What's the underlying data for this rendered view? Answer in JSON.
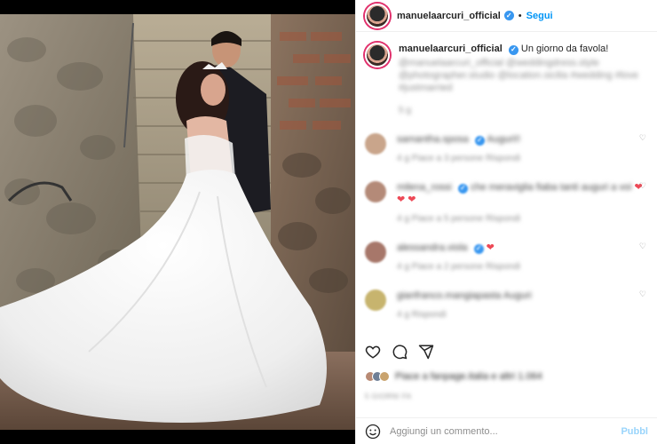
{
  "post": {
    "username": "manuelaarcuri_official",
    "follow_label": "Segui",
    "separator": "•",
    "caption": "Un giorno da favola!",
    "caption_blurred": "@manuelaarcuri_official @weddingdress.style @photographer.studio @location.sicilia #wedding #love #justmarried",
    "caption_time": "5 g"
  },
  "comments": [
    {
      "user": "samantha.sposa",
      "text": "Auguri!!",
      "meta": "4 g   Piace a 3 persone   Rispondi",
      "avatar_color": "#c9a58b",
      "hearts": ""
    },
    {
      "user": "milena_rossi",
      "text": "che meraviglia fiaba tanti auguri a voi",
      "meta": "4 g   Piace a 5 persone   Rispondi",
      "avatar_color": "#b48a78",
      "hearts": "❤ ❤ ❤"
    },
    {
      "user": "alessandra.viola",
      "text": "",
      "meta": "4 g   Piace a 2 persone   Rispondi",
      "avatar_color": "#a7776a",
      "hearts": "❤"
    },
    {
      "user": "gianfranco.mangiapasta",
      "text": "Auguri",
      "meta": "4 g   Rispondi",
      "avatar_color": "#c7b46e",
      "hearts": ""
    }
  ],
  "actions": {
    "like": "heart-icon",
    "comment": "comment-icon",
    "share": "share-icon"
  },
  "likes": {
    "text": "Piace a fanpage.italia e altri 1.064"
  },
  "date": "5 GIORNI FA",
  "add_comment": {
    "placeholder": "Aggiungi un commento...",
    "publish_label": "Pubbl"
  },
  "colors": {
    "accent": "#0095f6",
    "verified": "#3897f0",
    "heart": "#ed4956"
  }
}
